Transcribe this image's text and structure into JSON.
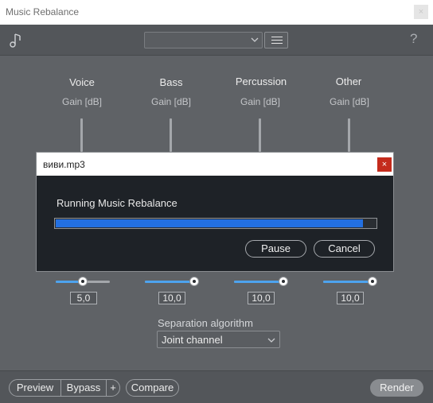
{
  "window": {
    "title": "Music Rebalance",
    "close_glyph": "×"
  },
  "toolbar": {
    "preset_value": "",
    "help_label": "?"
  },
  "columns": [
    {
      "name": "Voice",
      "unit": "Gain [dB]",
      "value": "5,0",
      "fraction": 0.5
    },
    {
      "name": "Bass",
      "unit": "Gain [dB]",
      "value": "10,0",
      "fraction": 1.0
    },
    {
      "name": "Percussion",
      "unit": "Gain [dB]",
      "value": "10,0",
      "fraction": 1.0
    },
    {
      "name": "Other",
      "unit": "Gain [dB]",
      "value": "10,0",
      "fraction": 1.0
    }
  ],
  "separation": {
    "label": "Separation algorithm",
    "selected": "Joint channel"
  },
  "footer": {
    "preview": "Preview",
    "bypass": "Bypass",
    "plus": "+",
    "compare": "Compare",
    "render": "Render"
  },
  "dialog": {
    "title": "виви.mp3",
    "close_glyph": "×",
    "message": "Running Music Rebalance",
    "progress": 0.96,
    "pause": "Pause",
    "cancel": "Cancel"
  },
  "colors": {
    "accent": "#4da3ee",
    "progress": "#2370e2",
    "dialog_close": "#c42b1c"
  }
}
